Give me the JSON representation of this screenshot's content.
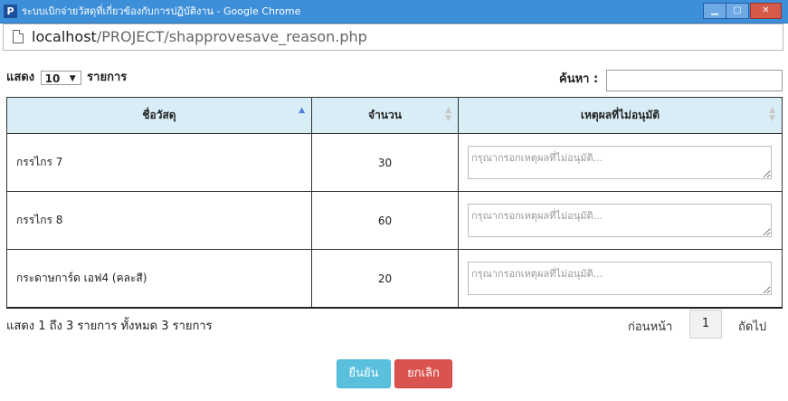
{
  "window": {
    "title": "ระบบเบิกจ่ายวัสดุที่เกี่ยวข้องกับการปฏิบัติงาน - Google Chrome",
    "app_icon": "P",
    "minimize_icon": "minimize-icon",
    "maximize_icon": "maximize-icon",
    "close_icon": "close-icon"
  },
  "address": {
    "host": "localhost",
    "path": "/PROJECT/shapprovesave_reason.php"
  },
  "length_control": {
    "prefix": "แสดง",
    "value": "10",
    "suffix": "รายการ"
  },
  "search": {
    "label": "ค้นหา :",
    "value": ""
  },
  "table": {
    "columns": [
      "ชื่อวัสดุ",
      "จำนวน",
      "เหตุผลที่ไม่อนุมัติ"
    ],
    "rows": [
      {
        "name": "กรรไกร 7",
        "qty": "30",
        "reason_placeholder": "กรุณากรอกเหตุผลที่ไม่อนุมัติ..."
      },
      {
        "name": "กรรไกร 8",
        "qty": "60",
        "reason_placeholder": "กรุณากรอกเหตุผลที่ไม่อนุมัติ..."
      },
      {
        "name": "กระดาษการ์ด เอฟ4 (คละสี)",
        "qty": "20",
        "reason_placeholder": "กรุณากรอกเหตุผลที่ไม่อนุมัติ..."
      }
    ]
  },
  "footer": {
    "info": "แสดง 1 ถึง 3 รายการ ทั้งหมด 3 รายการ",
    "prev": "ก่อนหน้า",
    "page": "1",
    "next": "ถัดไป"
  },
  "buttons": {
    "confirm": "ยืนยัน",
    "cancel": "ยกเลิก"
  },
  "colors": {
    "titlebar": "#3d8fd9",
    "header_bg": "#d9edf7",
    "confirm": "#5bc0de",
    "cancel": "#d9534f"
  }
}
